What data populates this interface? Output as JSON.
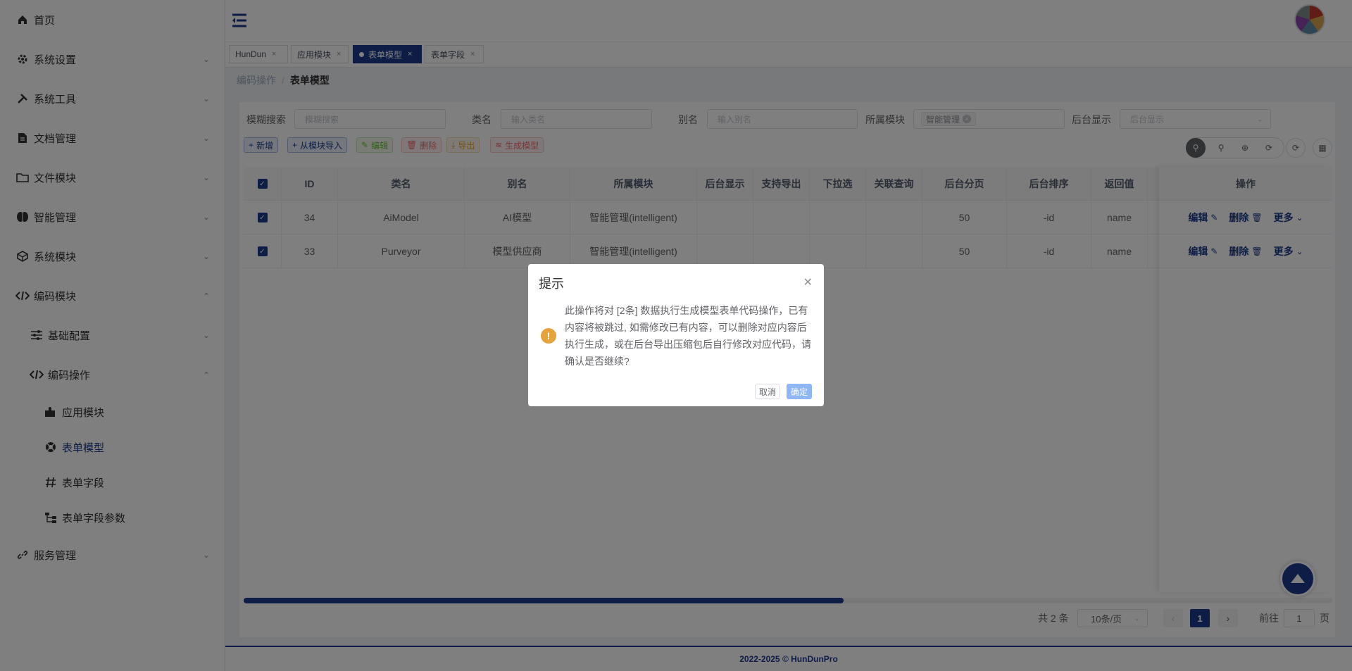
{
  "sidebar": {
    "items": [
      {
        "label": "首页",
        "icon": "home-icon"
      },
      {
        "label": "系统设置",
        "icon": "gear-icon"
      },
      {
        "label": "系统工具",
        "icon": "tools-icon"
      },
      {
        "label": "文档管理",
        "icon": "document-icon"
      },
      {
        "label": "文件模块",
        "icon": "folder-icon"
      },
      {
        "label": "智能管理",
        "icon": "brain-icon"
      },
      {
        "label": "系统模块",
        "icon": "cube-icon"
      },
      {
        "label": "编码模块",
        "icon": "code-icon"
      },
      {
        "label": "基础配置",
        "icon": "sliders-icon"
      },
      {
        "label": "编码操作",
        "icon": "code-icon"
      },
      {
        "label": "应用模块",
        "icon": "puzzle-icon"
      },
      {
        "label": "表单模型",
        "icon": "lifebuoy-icon"
      },
      {
        "label": "表单字段",
        "icon": "hash-icon"
      },
      {
        "label": "表单字段参数",
        "icon": "tree-icon"
      },
      {
        "label": "服务管理",
        "icon": "link-icon"
      }
    ]
  },
  "tabs": [
    {
      "label": "HunDun"
    },
    {
      "label": "应用模块"
    },
    {
      "label": "表单模型"
    },
    {
      "label": "表单字段"
    }
  ],
  "breadcrumb": {
    "parent": "编码操作",
    "current": "表单模型"
  },
  "filters": {
    "fuzzy_label": "模糊搜索",
    "fuzzy_placeholder": "模糊搜索",
    "class_label": "类名",
    "class_placeholder": "输入类名",
    "alias_label": "别名",
    "alias_placeholder": "输入别名",
    "module_label": "所属模块",
    "module_value": "智能管理",
    "backend_label": "后台显示",
    "backend_placeholder": "后台显示"
  },
  "toolbar": {
    "add": "新增",
    "import": "从模块导入",
    "edit": "编辑",
    "delete": "删除",
    "export": "导出",
    "generate": "生成模型"
  },
  "table": {
    "headers": [
      "ID",
      "类名",
      "别名",
      "所属模块",
      "后台显示",
      "支持导出",
      "下拉选",
      "关联查询",
      "后台分页",
      "后台排序",
      "返回值",
      "操作"
    ],
    "rows": [
      {
        "id": "34",
        "class": "AiModel",
        "alias": "AI模型",
        "module": "智能管理(intelligent)",
        "page": "50",
        "sort": "-id",
        "ret": "name"
      },
      {
        "id": "33",
        "class": "Purveyor",
        "alias": "模型供应商",
        "module": "智能管理(intelligent)",
        "page": "50",
        "sort": "-id",
        "ret": "name"
      }
    ],
    "actions": {
      "edit": "编辑",
      "delete": "删除",
      "more": "更多"
    }
  },
  "pagination": {
    "total": "共 2 条",
    "size": "10条/页",
    "current": "1",
    "goto_label": "前往",
    "goto_value": "1",
    "page_suffix": "页"
  },
  "footer": "2022-2025 © HunDunPro",
  "dialog": {
    "title": "提示",
    "message": "此操作将对 [2条] 数据执行生成模型表单代码操作，已有内容将被跳过, 如需修改已有内容，可以删除对应内容后执行生成，或在后台导出压缩包后自行修改对应代码，请确认是否继续?",
    "cancel": "取消",
    "confirm": "确定"
  },
  "colors": {
    "primary": "#1b3a8c",
    "warning": "#e6a23c",
    "danger": "#f56c6c",
    "success": "#67c23a"
  }
}
